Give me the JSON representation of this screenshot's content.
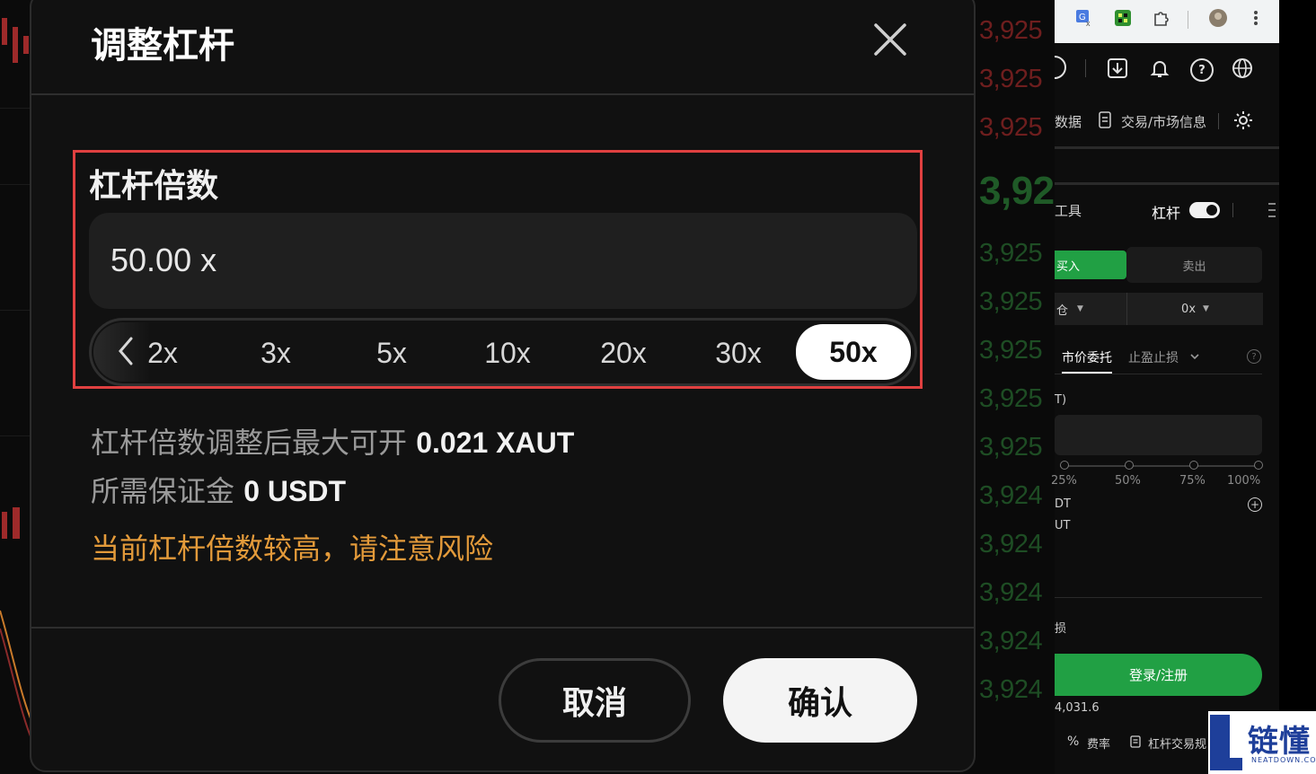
{
  "dialog": {
    "title": "调整杠杆",
    "leverage_label": "杠杆倍数",
    "leverage_value": "50.00 x",
    "presets": [
      "2x",
      "3x",
      "5x",
      "10x",
      "20x",
      "30x",
      "50x"
    ],
    "selected_preset": "50x",
    "max_open_label": "杠杆倍数调整后最大可开",
    "max_open_value": "0.021 XAUT",
    "margin_label": "所需保证金",
    "margin_value": "0 USDT",
    "warning": "当前杠杆倍数较高，请注意风险",
    "cancel_label": "取消",
    "confirm_label": "确认",
    "warning_color": "#e39a3a",
    "highlight_color": "#e04040"
  },
  "background_prices": {
    "red": [
      "3,925",
      "3,925",
      "3,925"
    ],
    "big": "3,92",
    "green": [
      "3,925",
      "3,925",
      "3,925",
      "3,925",
      "3,925",
      "3,924",
      "3,924",
      "3,924",
      "3,924",
      "3,924"
    ]
  },
  "right_panel": {
    "nav_data": "数据",
    "nav_trade_info": "交易/市场信息",
    "tools_label": "工具",
    "leverage_toggle_label": "杠杆",
    "buy_label": "买入",
    "sell_label": "卖出",
    "margin_mode": "仓",
    "leverage_select": "0x",
    "tab_market": "市价委托",
    "tab_tpsl": "止盈止损",
    "amount_unit": "T)",
    "slider_labels": [
      "25%",
      "50%",
      "75%",
      "100%"
    ],
    "avail_1": "DT",
    "avail_2": "UT",
    "sl_label": "损",
    "login_label": "登录/注册",
    "price_footer": "4,031.6",
    "fee_label": "费率",
    "rules_label": "杠杆交易规"
  },
  "watermark": {
    "text": "链懂",
    "sub": "NEATDOWN.COM",
    "color": "#1e3f9a"
  }
}
